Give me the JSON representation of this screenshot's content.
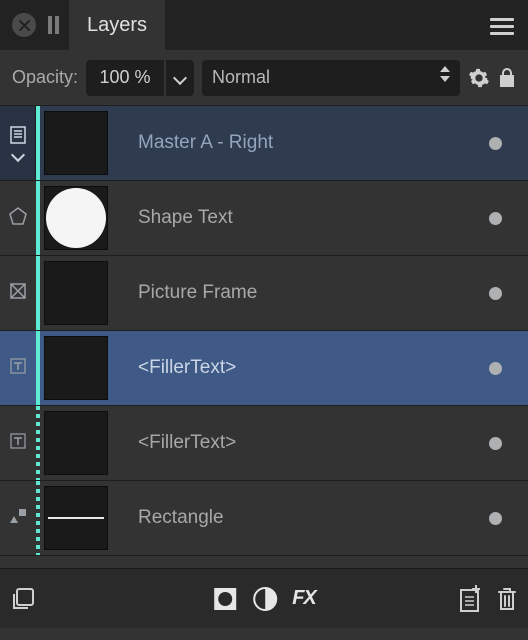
{
  "tabs": {
    "active_label": "Layers"
  },
  "options": {
    "opacity_label": "Opacity:",
    "opacity_value": "100 %",
    "blend_mode": "Normal"
  },
  "master": {
    "label": "Master A - Right"
  },
  "children": [
    {
      "type": "shape-text",
      "label": "Shape Text",
      "thumb": "circle",
      "stripe": "solid"
    },
    {
      "type": "picture-frame",
      "label": "Picture Frame",
      "thumb": "empty",
      "stripe": "solid"
    },
    {
      "type": "text-frame",
      "label": "<FillerText>",
      "thumb": "empty",
      "stripe": "solid",
      "selected": true
    },
    {
      "type": "text-frame",
      "label": "<FillerText>",
      "thumb": "empty",
      "stripe": "dotted"
    },
    {
      "type": "rectangle",
      "label": "Rectangle",
      "thumb": "hline",
      "stripe": "dotted"
    }
  ],
  "bottom": {
    "fx_label": "FX"
  }
}
